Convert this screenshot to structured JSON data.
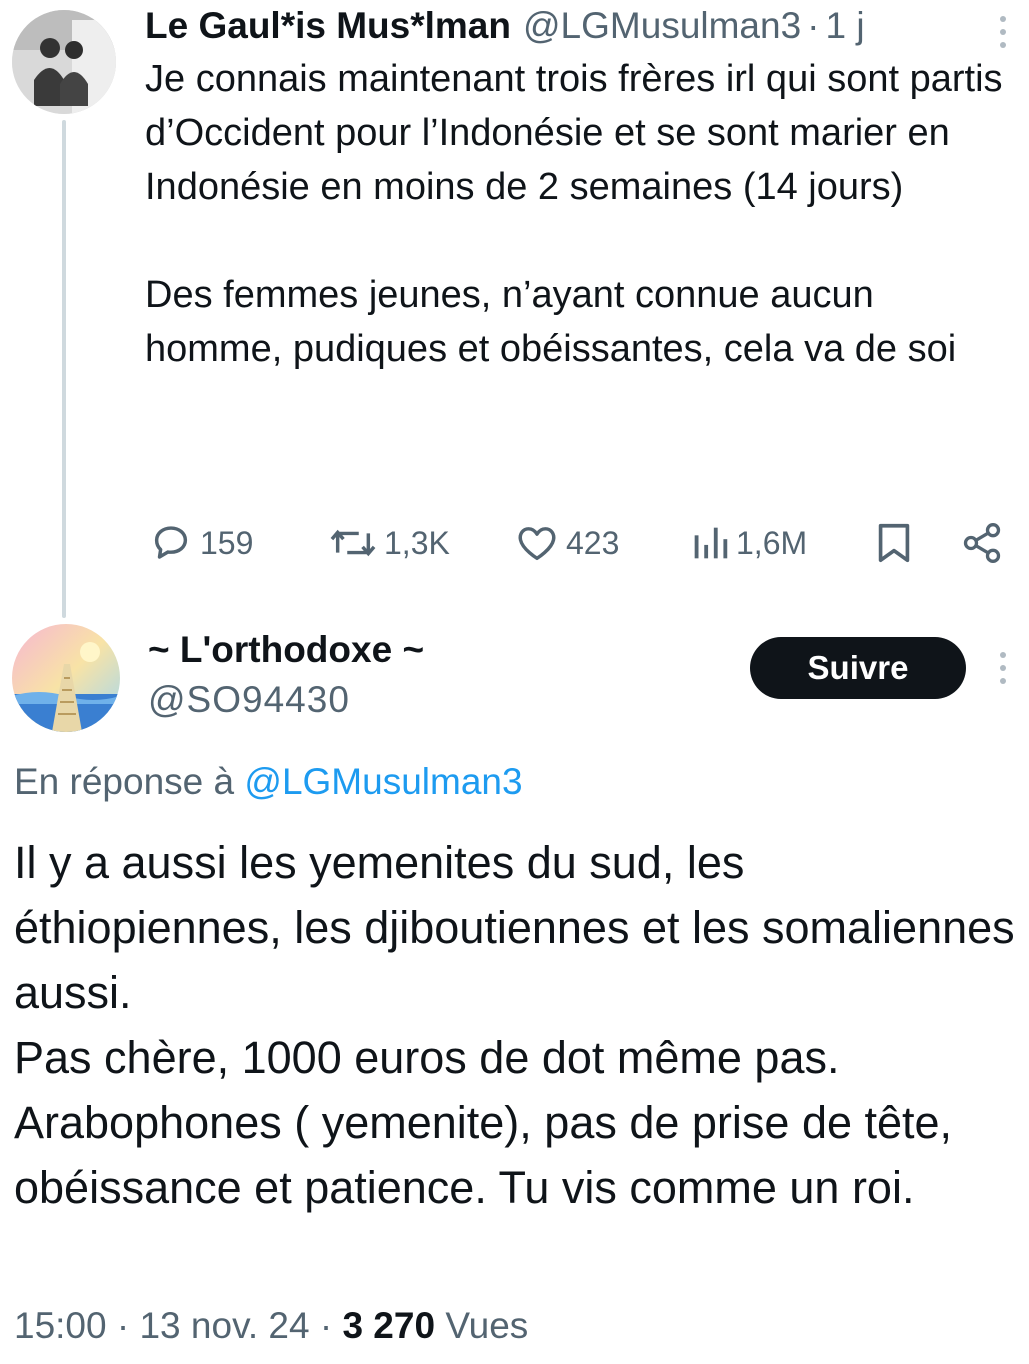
{
  "parent_tweet": {
    "display_name": "Le Gaul*is Mus*lman",
    "handle": "@LGMusulman3",
    "separator": "·",
    "time": "1 j",
    "text": "Je connais maintenant trois frères irl qui sont partis d’Occident pour l’Indonésie et se sont marier en Indonésie en moins de 2 semaines (14 jours)\n\nDes femmes jeunes, n’ayant connue aucun homme, pudiques et obéissantes, cela va de soi",
    "actions": {
      "replies": "159",
      "reposts": "1,3K",
      "likes": "423",
      "views": "1,6M"
    },
    "icons": [
      "more-icon",
      "reply-icon",
      "repost-icon",
      "like-icon",
      "views-icon",
      "bookmark-icon",
      "share-icon"
    ]
  },
  "reply_tweet": {
    "display_name": "~ L'orthodoxe ~",
    "handle": "@SO94430",
    "follow_label": "Suivre",
    "reply_prefix": "En réponse à",
    "reply_to_handle": "@LGMusulman3",
    "text": "Il y a aussi les yemenites du sud, les éthiopiennes, les djiboutiennes et les somaliennes aussi.\nPas chère, 1000 euros de dot même pas.\nArabophones ( yemenite), pas de prise de tête, obéissance et patience. Tu vis comme un roi.",
    "time": "15:00",
    "date": "13 nov. 24",
    "views_count": "3 270",
    "views_label": "Vues",
    "separator": "·"
  },
  "colors": {
    "text": "#0f1419",
    "secondary": "#536471",
    "link": "#1d9bf0",
    "thread_line": "#cfd9de",
    "button_bg": "#0f1419",
    "button_text": "#ffffff"
  }
}
